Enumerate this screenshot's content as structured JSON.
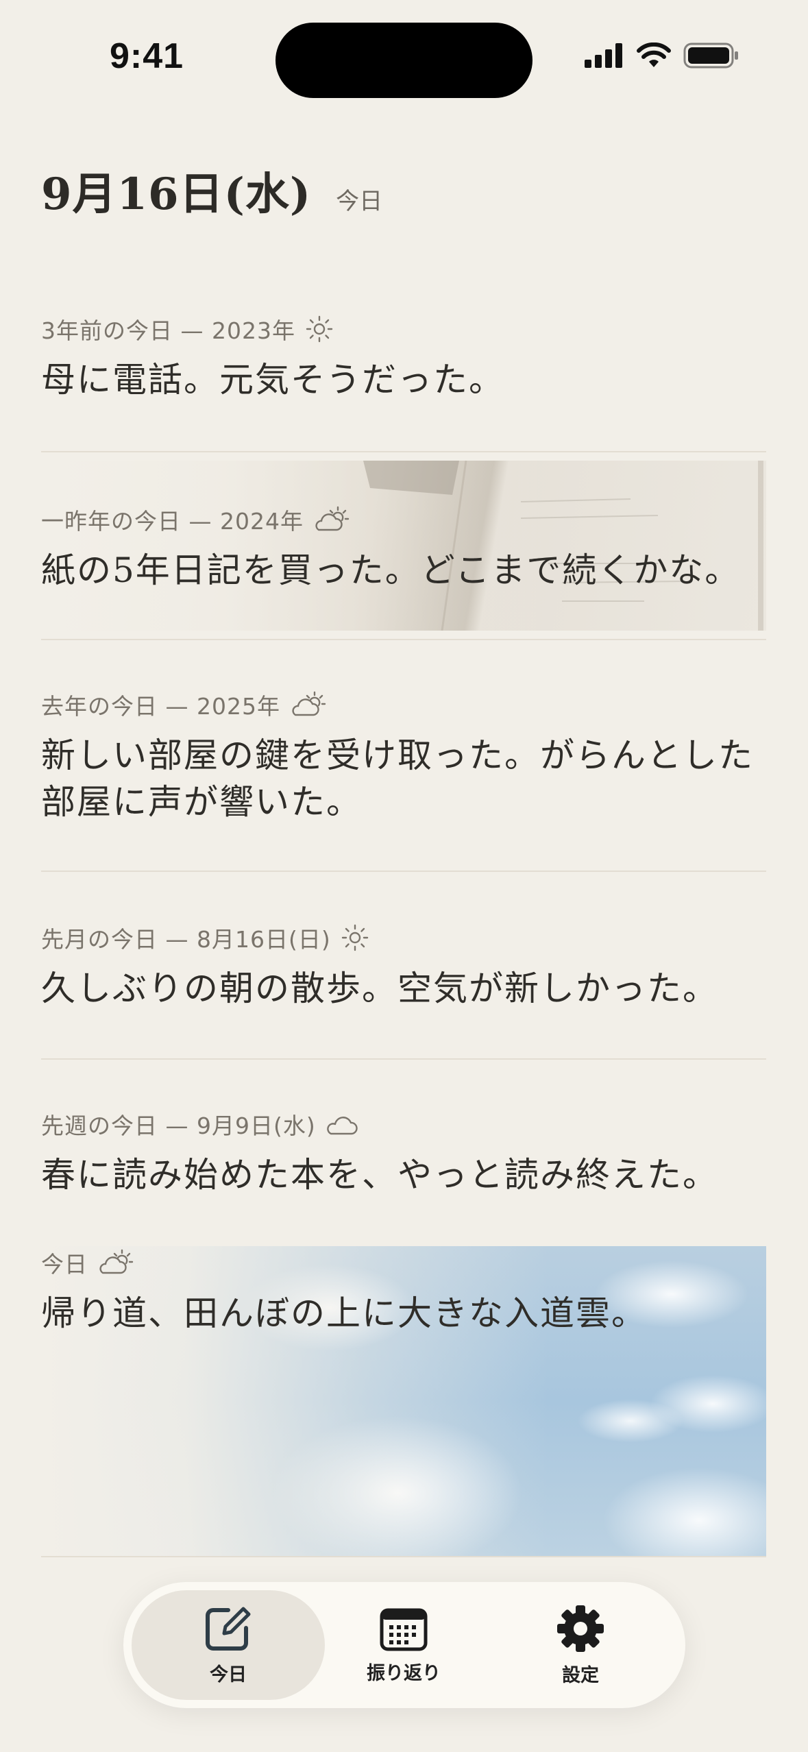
{
  "status_bar": {
    "time": "9:41"
  },
  "header": {
    "date": "9月16日(水)",
    "tag": "今日"
  },
  "entries": [
    {
      "meta": "3年前の今日 — 2023年",
      "weather_icon": "sun-icon",
      "text": "母に電話。元気そうだった。"
    },
    {
      "meta": "一昨年の今日 — 2024年",
      "weather_icon": "partly-cloudy-icon",
      "text": "紙の5年日記を買った。どこまで続くかな。",
      "photo": "diary-notebook-photo"
    },
    {
      "meta": "去年の今日 — 2025年",
      "weather_icon": "partly-cloudy-icon",
      "text": "新しい部屋の鍵を受け取った。がらんとした部屋に声が響いた。"
    },
    {
      "meta": "先月の今日 — 8月16日(日)",
      "weather_icon": "sun-icon",
      "text": "久しぶりの朝の散歩。空気が新しかった。"
    },
    {
      "meta": "先週の今日 — 9月9日(水)",
      "weather_icon": "cloud-icon",
      "text": "春に読み始めた本を、やっと読み終えた。"
    },
    {
      "meta": "今日",
      "weather_icon": "partly-cloudy-icon",
      "text": "帰り道、田んぼの上に大きな入道雲。",
      "photo": "sky-clouds-photo"
    }
  ],
  "tabbar": {
    "tabs": [
      {
        "label": "今日",
        "icon": "compose-icon",
        "active": true
      },
      {
        "label": "振り返り",
        "icon": "calendar-icon",
        "active": false
      },
      {
        "label": "設定",
        "icon": "gear-icon",
        "active": false
      }
    ]
  }
}
